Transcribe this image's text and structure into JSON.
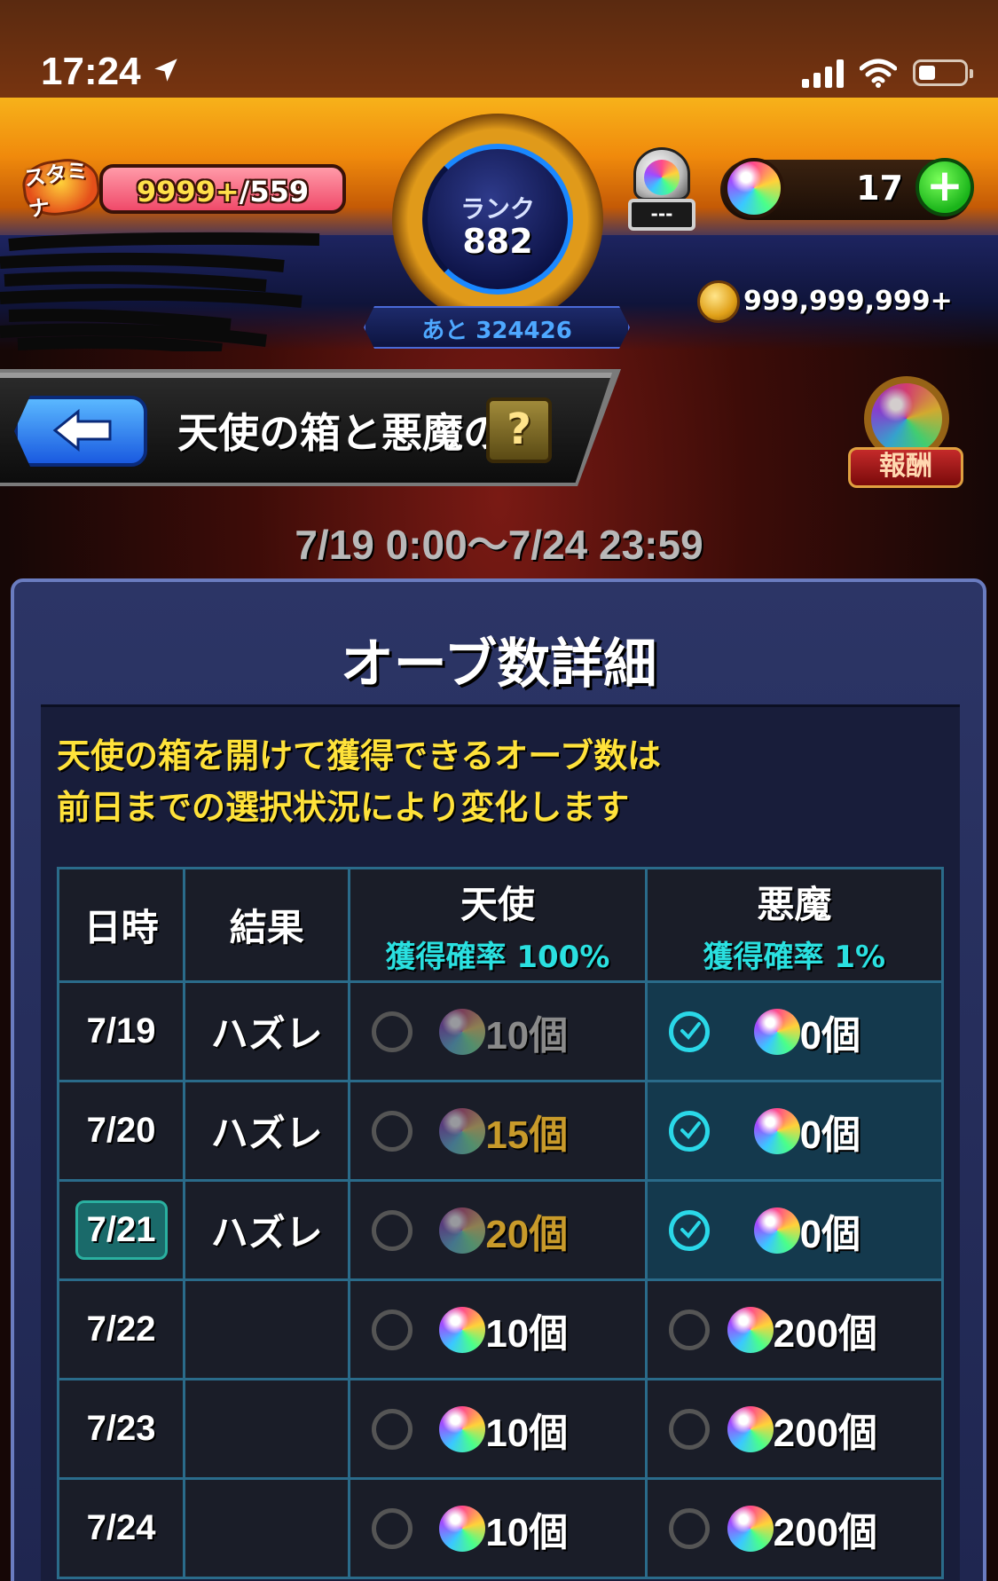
{
  "status_bar": {
    "time": "17:24"
  },
  "header": {
    "stamina_label": "スタミナ",
    "stamina_current": "9999+",
    "stamina_max": "/559",
    "stamina_fill_fraction": 1.0,
    "rank_label": "ランク",
    "rank_value": "882",
    "rank_remaining": "あと 324426",
    "gift_tag": "---",
    "orb_count": "17",
    "plus_label": "+",
    "coin_value": "999,999,999+"
  },
  "title_bar": {
    "title": "天使の箱と悪魔の箱",
    "help_label": "?",
    "reward_label": "報酬"
  },
  "event_period": "7/19 0:00〜7/24 23:59",
  "panel": {
    "title": "オーブ数詳細",
    "notice_line1": "天使の箱を開けて獲得できるオーブ数は",
    "notice_line2": "前日までの選択状況により変化します"
  },
  "table": {
    "headers": {
      "date": "日時",
      "result": "結果",
      "angel": "天使",
      "angel_rate": "獲得確率 100%",
      "devil": "悪魔",
      "devil_rate": "獲得確率 1%"
    },
    "rows": [
      {
        "date": "7/19",
        "result": "ハズレ",
        "angel_count": "10個",
        "devil_count": "0個",
        "selected": "devil"
      },
      {
        "date": "7/20",
        "result": "ハズレ",
        "angel_count": "15個",
        "devil_count": "0個",
        "selected": "devil"
      },
      {
        "date": "7/21",
        "result": "ハズレ",
        "angel_count": "20個",
        "devil_count": "0個",
        "selected": "devil",
        "today": true
      },
      {
        "date": "7/22",
        "result": "",
        "angel_count": "10個",
        "devil_count": "200個",
        "selected": ""
      },
      {
        "date": "7/23",
        "result": "",
        "angel_count": "10個",
        "devil_count": "200個",
        "selected": ""
      },
      {
        "date": "7/24",
        "result": "",
        "angel_count": "10個",
        "devil_count": "200個",
        "selected": ""
      }
    ]
  },
  "colors": {
    "accent_cyan": "#2ae0e0",
    "notice_yellow": "#ffe23a",
    "table_border": "#2a6b8a"
  }
}
